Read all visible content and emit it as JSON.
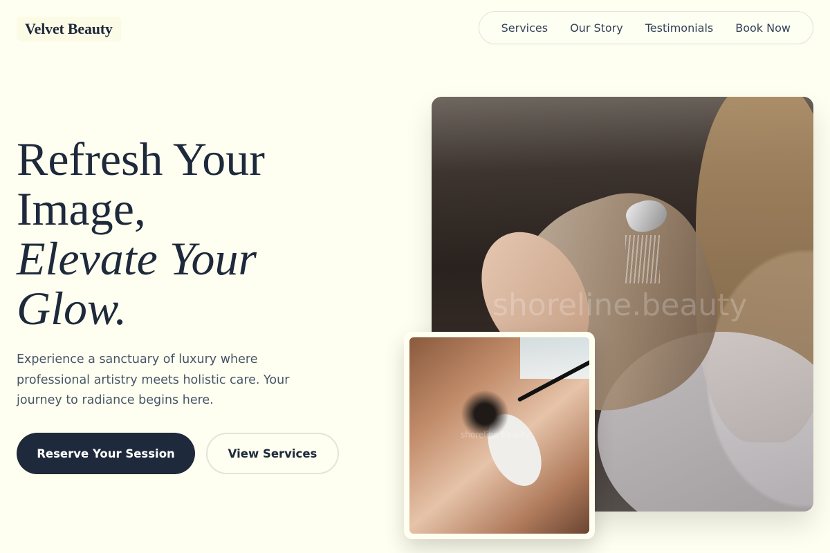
{
  "brand": {
    "name": "Velvet Beauty"
  },
  "nav": {
    "items": [
      {
        "label": "Services"
      },
      {
        "label": "Our Story"
      },
      {
        "label": "Testimonials"
      },
      {
        "label": "Book Now"
      }
    ]
  },
  "hero": {
    "headline_line1": "Refresh Your",
    "headline_line2": "Image,",
    "headline_line3": "Elevate Your",
    "headline_line4": "Glow.",
    "description": "Experience a sanctuary of luxury where professional artistry meets holistic care. Your journey to radiance begins here.",
    "primary_button": "Reserve Your Session",
    "secondary_button": "View Services"
  },
  "images": {
    "main_watermark": "shoreline.beauty",
    "small_watermark": "shoreline.beauty"
  },
  "colors": {
    "background": "#fefff0",
    "primary": "#1e293b",
    "text_muted": "#475569"
  }
}
